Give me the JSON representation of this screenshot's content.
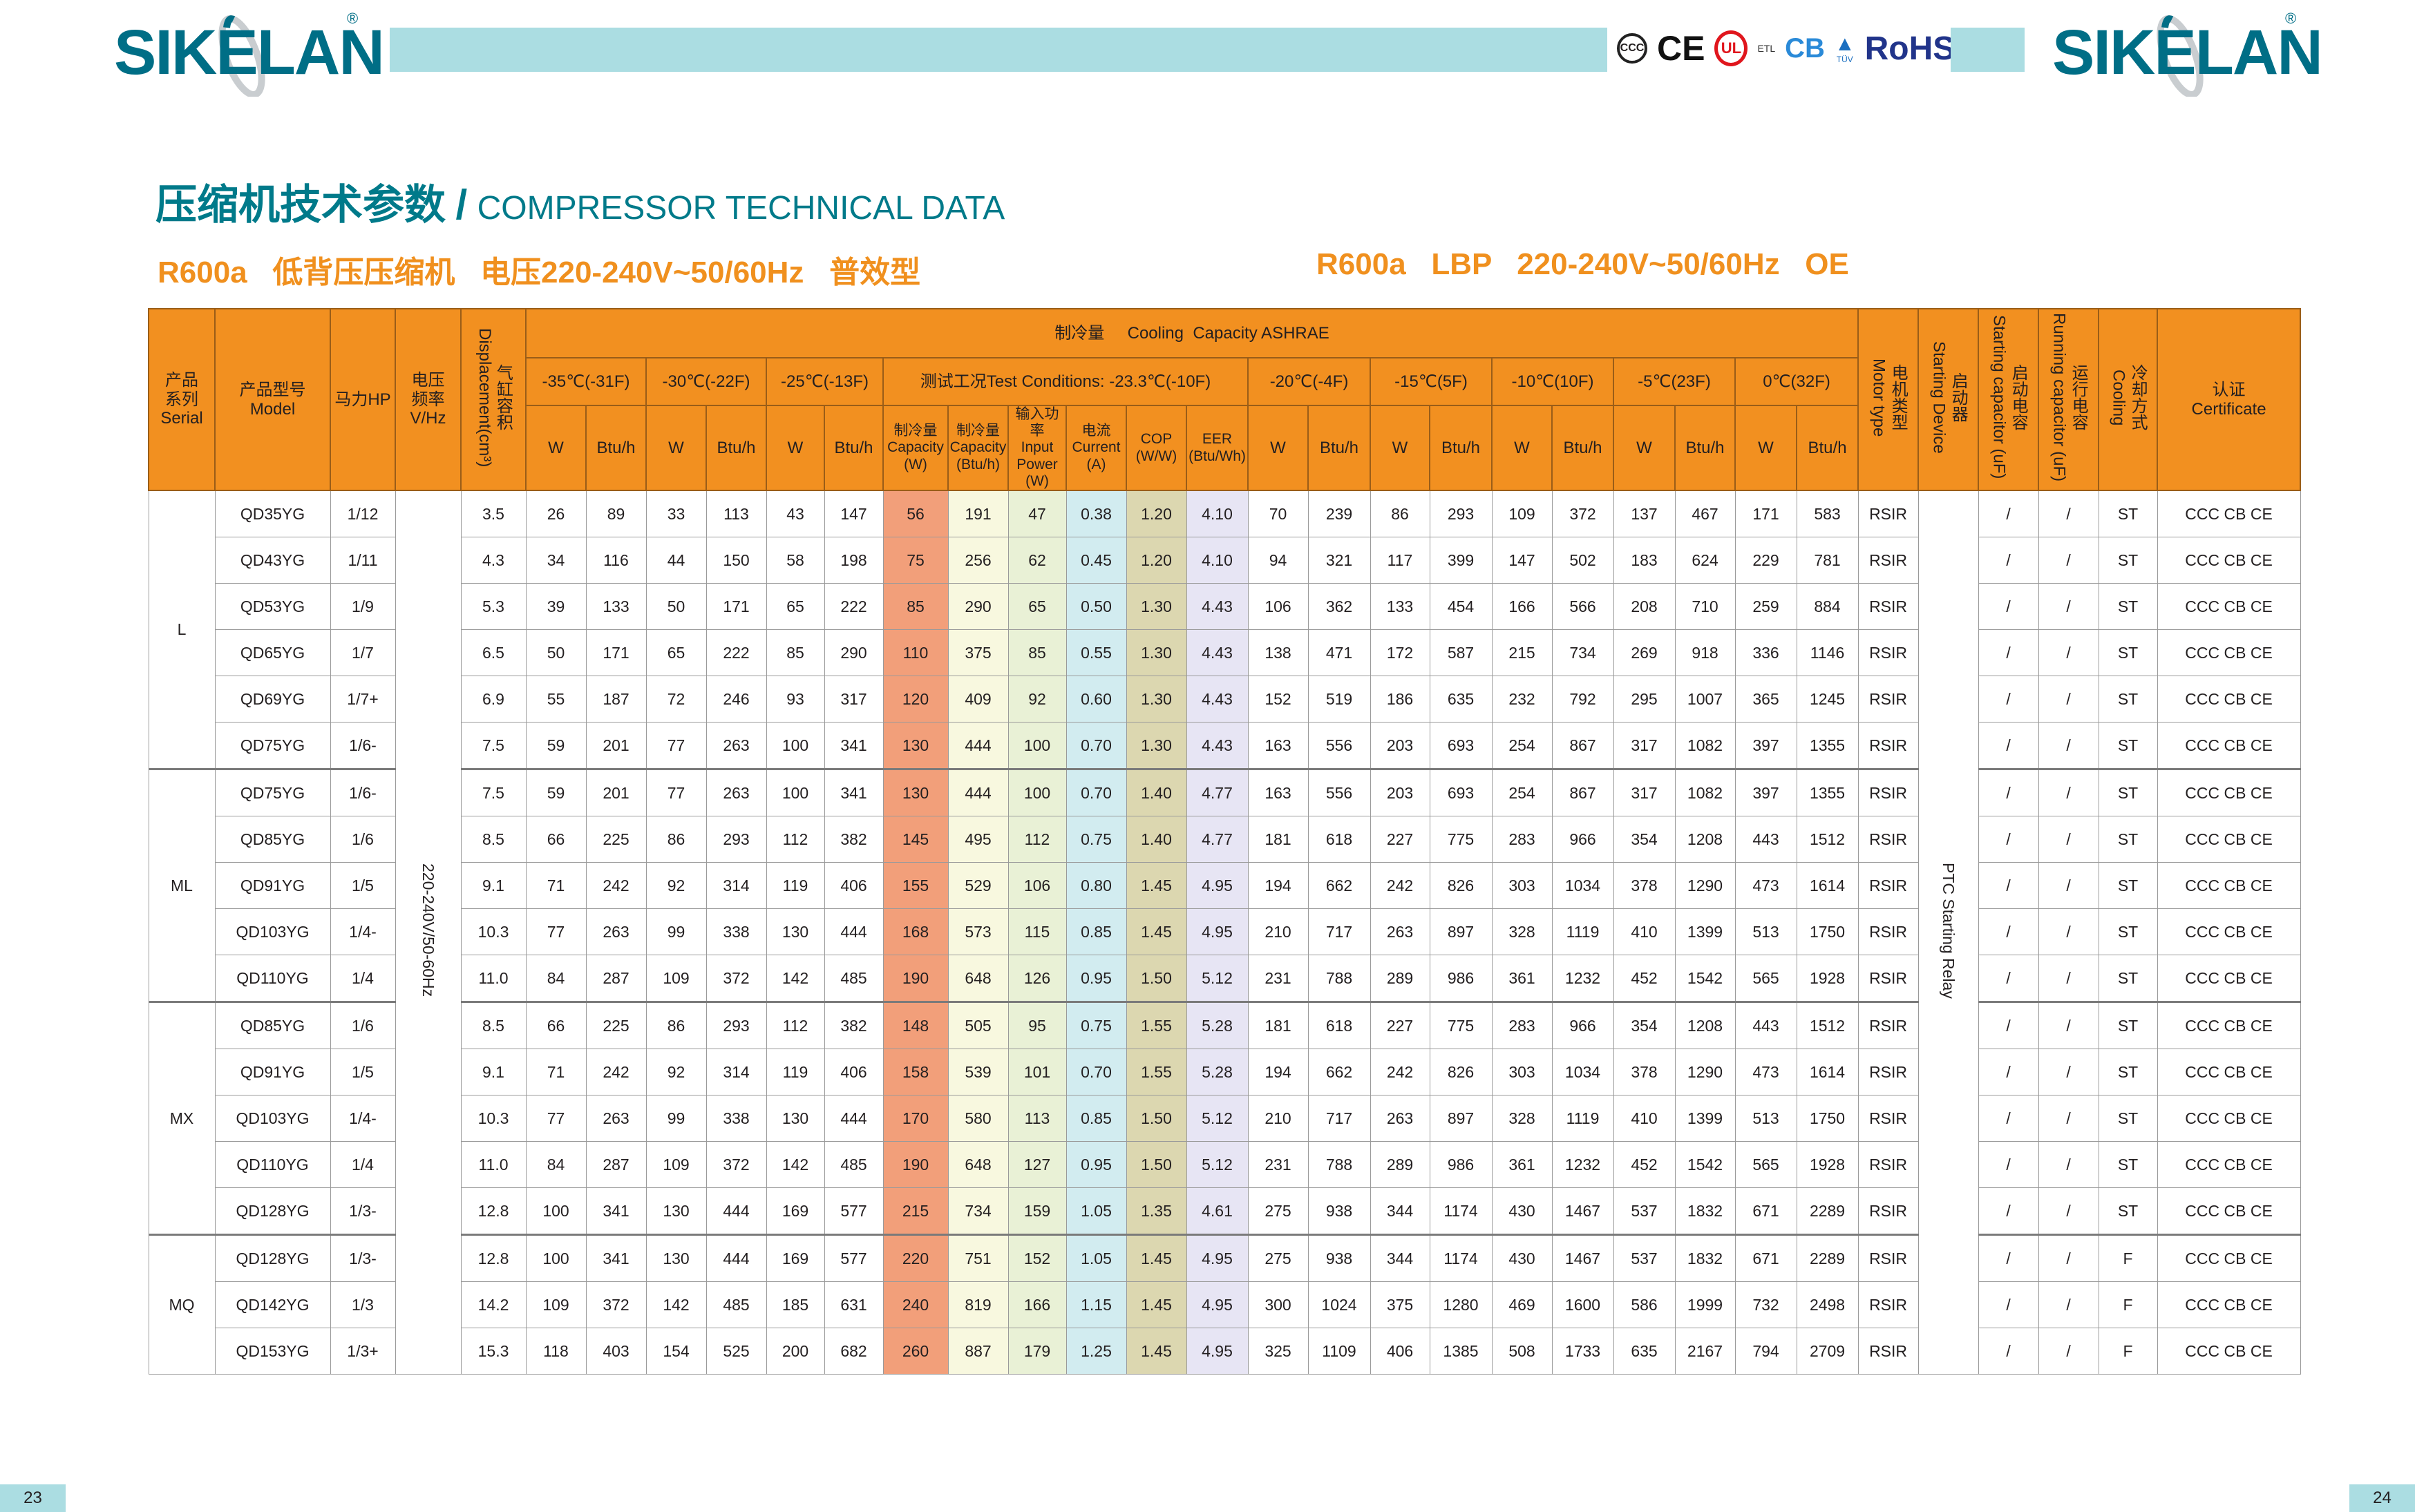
{
  "brand": {
    "name": "SIKELAN",
    "registered": "®"
  },
  "certifications": [
    "CCC",
    "CE",
    "UL",
    "ETL",
    "CB",
    "TÜV",
    "RoHS"
  ],
  "title": {
    "cn": "压缩机技术参数",
    "separator": "/",
    "en": "COMPRESSOR TECHNICAL DATA"
  },
  "subtitle": {
    "cn": "R600a   低背压压缩机   电压220-240V~50/60Hz   普效型",
    "en": "R600a   LBP   220-240V~50/60Hz   OE"
  },
  "colors": {
    "header": "#f29020",
    "teal": "#007a8a",
    "orange": "#f0901e",
    "capacity_w": "#f29f7a",
    "capacity_btu": "#f8f8df",
    "power": "#e9f1d6",
    "current": "#d2ecf0",
    "cop": "#dcd7b0",
    "eer": "#e7e5f4"
  },
  "table": {
    "headers": {
      "serial": "产品\n系列\nSerial",
      "model": "产品型号\nModel",
      "hp": "马力HP",
      "voltage": "电压\n频率\nV/Hz",
      "displacement_cn": "气缸容积",
      "displacement_en": "Displacement(cm³)",
      "cooling_capacity": "制冷量     Cooling  Capacity ASHRAE",
      "conditions": [
        "-35℃(-31F)",
        "-30℃(-22F)",
        "-25℃(-13F)",
        "测试工况Test Conditions: -23.3℃(-10F)",
        "-20℃(-4F)",
        "-15℃(5F)",
        "-10℃(10F)",
        "-5℃(23F)",
        "0℃(32F)"
      ],
      "unit_w": "W",
      "unit_btu": "Btu/h",
      "test_cols": [
        "制冷量\nCapacity\n(W)",
        "制冷量\nCapacity\n(Btu/h)",
        "输入功率\nInput\nPower\n(W)",
        "电流\nCurrent\n(A)",
        "COP\n(W/W)",
        "EER\n(Btu/Wh)"
      ],
      "motor_cn": "电机类型",
      "motor_en": "Motor type",
      "starting_cn": "启动器",
      "starting_en": "Starting Device",
      "start_cap_cn": "启动电容",
      "start_cap_en": "Starting capacitor (uF)",
      "run_cap_cn": "运行电容",
      "run_cap_en": "Running capacitor (uF)",
      "cooling_cn": "冷却方式",
      "cooling_en": "Cooling",
      "certificate": "认证\nCertificate"
    },
    "voltage_value": "220-240V/50-60Hz",
    "starting_device_value": "PTC Starting Relay",
    "groups": [
      {
        "serial": "L",
        "rows": [
          [
            "QD35YG",
            "1/12",
            "3.5",
            "26",
            "89",
            "33",
            "113",
            "43",
            "147",
            "56",
            "191",
            "47",
            "0.38",
            "1.20",
            "4.10",
            "70",
            "239",
            "86",
            "293",
            "109",
            "372",
            "137",
            "467",
            "171",
            "583",
            "RSIR",
            "/",
            "/",
            "ST",
            "CCC CB CE"
          ],
          [
            "QD43YG",
            "1/11",
            "4.3",
            "34",
            "116",
            "44",
            "150",
            "58",
            "198",
            "75",
            "256",
            "62",
            "0.45",
            "1.20",
            "4.10",
            "94",
            "321",
            "117",
            "399",
            "147",
            "502",
            "183",
            "624",
            "229",
            "781",
            "RSIR",
            "/",
            "/",
            "ST",
            "CCC CB CE"
          ],
          [
            "QD53YG",
            "1/9",
            "5.3",
            "39",
            "133",
            "50",
            "171",
            "65",
            "222",
            "85",
            "290",
            "65",
            "0.50",
            "1.30",
            "4.43",
            "106",
            "362",
            "133",
            "454",
            "166",
            "566",
            "208",
            "710",
            "259",
            "884",
            "RSIR",
            "/",
            "/",
            "ST",
            "CCC CB CE"
          ],
          [
            "QD65YG",
            "1/7",
            "6.5",
            "50",
            "171",
            "65",
            "222",
            "85",
            "290",
            "110",
            "375",
            "85",
            "0.55",
            "1.30",
            "4.43",
            "138",
            "471",
            "172",
            "587",
            "215",
            "734",
            "269",
            "918",
            "336",
            "1146",
            "RSIR",
            "/",
            "/",
            "ST",
            "CCC CB CE"
          ],
          [
            "QD69YG",
            "1/7+",
            "6.9",
            "55",
            "187",
            "72",
            "246",
            "93",
            "317",
            "120",
            "409",
            "92",
            "0.60",
            "1.30",
            "4.43",
            "152",
            "519",
            "186",
            "635",
            "232",
            "792",
            "295",
            "1007",
            "365",
            "1245",
            "RSIR",
            "/",
            "/",
            "ST",
            "CCC CB CE"
          ],
          [
            "QD75YG",
            "1/6-",
            "7.5",
            "59",
            "201",
            "77",
            "263",
            "100",
            "341",
            "130",
            "444",
            "100",
            "0.70",
            "1.30",
            "4.43",
            "163",
            "556",
            "203",
            "693",
            "254",
            "867",
            "317",
            "1082",
            "397",
            "1355",
            "RSIR",
            "/",
            "/",
            "ST",
            "CCC CB CE"
          ]
        ]
      },
      {
        "serial": "ML",
        "rows": [
          [
            "QD75YG",
            "1/6-",
            "7.5",
            "59",
            "201",
            "77",
            "263",
            "100",
            "341",
            "130",
            "444",
            "100",
            "0.70",
            "1.40",
            "4.77",
            "163",
            "556",
            "203",
            "693",
            "254",
            "867",
            "317",
            "1082",
            "397",
            "1355",
            "RSIR",
            "/",
            "/",
            "ST",
            "CCC CB CE"
          ],
          [
            "QD85YG",
            "1/6",
            "8.5",
            "66",
            "225",
            "86",
            "293",
            "112",
            "382",
            "145",
            "495",
            "112",
            "0.75",
            "1.40",
            "4.77",
            "181",
            "618",
            "227",
            "775",
            "283",
            "966",
            "354",
            "1208",
            "443",
            "1512",
            "RSIR",
            "/",
            "/",
            "ST",
            "CCC CB CE"
          ],
          [
            "QD91YG",
            "1/5",
            "9.1",
            "71",
            "242",
            "92",
            "314",
            "119",
            "406",
            "155",
            "529",
            "106",
            "0.80",
            "1.45",
            "4.95",
            "194",
            "662",
            "242",
            "826",
            "303",
            "1034",
            "378",
            "1290",
            "473",
            "1614",
            "RSIR",
            "/",
            "/",
            "ST",
            "CCC CB CE"
          ],
          [
            "QD103YG",
            "1/4-",
            "10.3",
            "77",
            "263",
            "99",
            "338",
            "130",
            "444",
            "168",
            "573",
            "115",
            "0.85",
            "1.45",
            "4.95",
            "210",
            "717",
            "263",
            "897",
            "328",
            "1119",
            "410",
            "1399",
            "513",
            "1750",
            "RSIR",
            "/",
            "/",
            "ST",
            "CCC CB CE"
          ],
          [
            "QD110YG",
            "1/4",
            "11.0",
            "84",
            "287",
            "109",
            "372",
            "142",
            "485",
            "190",
            "648",
            "126",
            "0.95",
            "1.50",
            "5.12",
            "231",
            "788",
            "289",
            "986",
            "361",
            "1232",
            "452",
            "1542",
            "565",
            "1928",
            "RSIR",
            "/",
            "/",
            "ST",
            "CCC CB CE"
          ]
        ]
      },
      {
        "serial": "MX",
        "rows": [
          [
            "QD85YG",
            "1/6",
            "8.5",
            "66",
            "225",
            "86",
            "293",
            "112",
            "382",
            "148",
            "505",
            "95",
            "0.75",
            "1.55",
            "5.28",
            "181",
            "618",
            "227",
            "775",
            "283",
            "966",
            "354",
            "1208",
            "443",
            "1512",
            "RSIR",
            "/",
            "/",
            "ST",
            "CCC CB CE"
          ],
          [
            "QD91YG",
            "1/5",
            "9.1",
            "71",
            "242",
            "92",
            "314",
            "119",
            "406",
            "158",
            "539",
            "101",
            "0.70",
            "1.55",
            "5.28",
            "194",
            "662",
            "242",
            "826",
            "303",
            "1034",
            "378",
            "1290",
            "473",
            "1614",
            "RSIR",
            "/",
            "/",
            "ST",
            "CCC CB CE"
          ],
          [
            "QD103YG",
            "1/4-",
            "10.3",
            "77",
            "263",
            "99",
            "338",
            "130",
            "444",
            "170",
            "580",
            "113",
            "0.85",
            "1.50",
            "5.12",
            "210",
            "717",
            "263",
            "897",
            "328",
            "1119",
            "410",
            "1399",
            "513",
            "1750",
            "RSIR",
            "/",
            "/",
            "ST",
            "CCC CB CE"
          ],
          [
            "QD110YG",
            "1/4",
            "11.0",
            "84",
            "287",
            "109",
            "372",
            "142",
            "485",
            "190",
            "648",
            "127",
            "0.95",
            "1.50",
            "5.12",
            "231",
            "788",
            "289",
            "986",
            "361",
            "1232",
            "452",
            "1542",
            "565",
            "1928",
            "RSIR",
            "/",
            "/",
            "ST",
            "CCC CB CE"
          ],
          [
            "QD128YG",
            "1/3-",
            "12.8",
            "100",
            "341",
            "130",
            "444",
            "169",
            "577",
            "215",
            "734",
            "159",
            "1.05",
            "1.35",
            "4.61",
            "275",
            "938",
            "344",
            "1174",
            "430",
            "1467",
            "537",
            "1832",
            "671",
            "2289",
            "RSIR",
            "/",
            "/",
            "ST",
            "CCC CB CE"
          ]
        ]
      },
      {
        "serial": "MQ",
        "rows": [
          [
            "QD128YG",
            "1/3-",
            "12.8",
            "100",
            "341",
            "130",
            "444",
            "169",
            "577",
            "220",
            "751",
            "152",
            "1.05",
            "1.45",
            "4.95",
            "275",
            "938",
            "344",
            "1174",
            "430",
            "1467",
            "537",
            "1832",
            "671",
            "2289",
            "RSIR",
            "/",
            "/",
            "F",
            "CCC CB CE"
          ],
          [
            "QD142YG",
            "1/3",
            "14.2",
            "109",
            "372",
            "142",
            "485",
            "185",
            "631",
            "240",
            "819",
            "166",
            "1.15",
            "1.45",
            "4.95",
            "300",
            "1024",
            "375",
            "1280",
            "469",
            "1600",
            "586",
            "1999",
            "732",
            "2498",
            "RSIR",
            "/",
            "/",
            "F",
            "CCC CB CE"
          ],
          [
            "QD153YG",
            "1/3+",
            "15.3",
            "118",
            "403",
            "154",
            "525",
            "200",
            "682",
            "260",
            "887",
            "179",
            "1.25",
            "1.45",
            "4.95",
            "325",
            "1109",
            "406",
            "1385",
            "508",
            "1733",
            "635",
            "2167",
            "794",
            "2709",
            "RSIR",
            "/",
            "/",
            "F",
            "CCC CB CE"
          ]
        ]
      }
    ]
  },
  "pages": {
    "left": "23",
    "right": "24"
  }
}
